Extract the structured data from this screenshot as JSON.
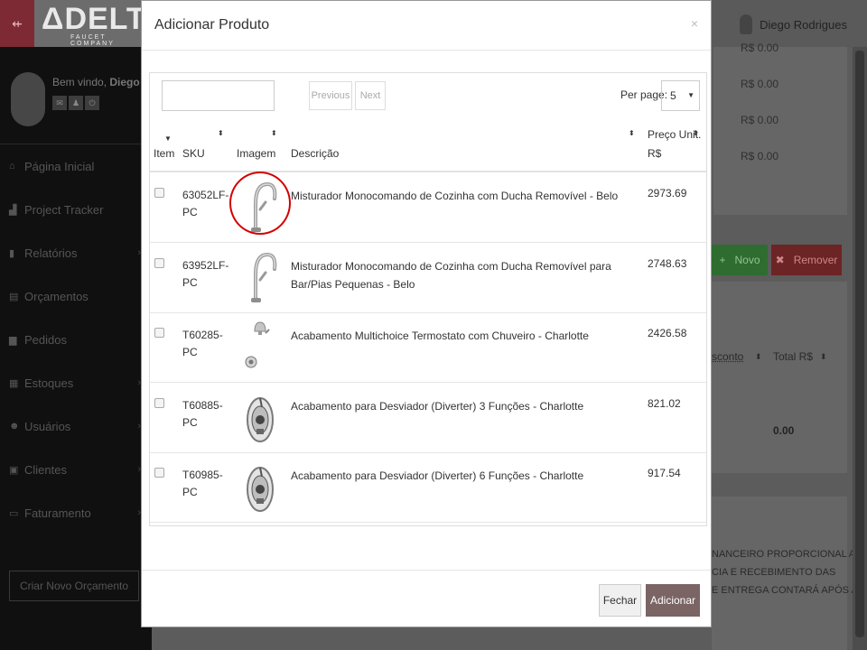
{
  "topbar": {
    "menu_icon": "menu-toggle-icon",
    "logo_text": "ΔDELTA",
    "logo_sub": "FAUCET COMPANY",
    "user_name": "Diego Rodrigues"
  },
  "sidebar": {
    "welcome_prefix": "Bem vindo,",
    "welcome_name": "Diego",
    "items": [
      {
        "label": "Página Inicial",
        "icon": "dashboard-icon",
        "glyph": "⌂",
        "has_submenu": false
      },
      {
        "label": "Project Tracker",
        "icon": "building-icon",
        "glyph": "▟",
        "has_submenu": false
      },
      {
        "label": "Relatórios",
        "icon": "bar-chart-icon",
        "glyph": "▮",
        "has_submenu": true
      },
      {
        "label": "Orçamentos",
        "icon": "document-icon",
        "glyph": "▤",
        "has_submenu": false
      },
      {
        "label": "Pedidos",
        "icon": "truck-icon",
        "glyph": "▆",
        "has_submenu": false
      },
      {
        "label": "Estoques",
        "icon": "inventory-icon",
        "glyph": "▦",
        "has_submenu": true
      },
      {
        "label": "Usuários",
        "icon": "users-icon",
        "glyph": "☻",
        "has_submenu": true
      },
      {
        "label": "Clientes",
        "icon": "briefcase-icon",
        "glyph": "▣",
        "has_submenu": true
      },
      {
        "label": "Faturamento",
        "icon": "money-icon",
        "glyph": "▭",
        "has_submenu": true
      }
    ],
    "new_quote_label": "Criar Novo Orçamento"
  },
  "background": {
    "prices": [
      "R$ 0.00",
      "R$ 0.00",
      "R$ 0.00",
      "R$ 0.00"
    ],
    "novo_label": "Novo",
    "remover_label": "Remover",
    "col_desconto": "sconto",
    "col_total": "Total R$",
    "total_value": "0.00",
    "notes": [
      "NANCEIRO PROPORCIONAL A",
      "CIA E RECEBIMENTO DAS",
      "E ENTREGA CONTARÁ APÓS A"
    ]
  },
  "modal": {
    "title": "Adicionar Produto",
    "close_label": "×",
    "search": {
      "value": "",
      "placeholder": ""
    },
    "pagination": {
      "previous": "Previous",
      "next": "Next"
    },
    "per_page_label": "Per page:",
    "per_page_value": "5",
    "columns": {
      "item": "Item",
      "sku": "SKU",
      "imagem": "Imagem",
      "descricao": "Descrição",
      "preco": "Preço Unit.",
      "preco_unit": "R$"
    },
    "rows": [
      {
        "sku": "63052LF-PC",
        "description": "Misturador Monocomando de Cozinha com Ducha Removível - Belo",
        "price": "2973.69",
        "image_type": "faucet",
        "highlighted": true
      },
      {
        "sku": "63952LF-PC",
        "description": "Misturador Monocomando de Cozinha com Ducha Removível para Bar/Pias Pequenas - Belo",
        "price": "2748.63",
        "image_type": "faucet",
        "highlighted": false
      },
      {
        "sku": "T60285-PC",
        "description": "Acabamento Multichoice Termostato com Chuveiro - Charlotte",
        "price": "2426.58",
        "image_type": "shower-set",
        "highlighted": false
      },
      {
        "sku": "T60885-PC",
        "description": "Acabamento para Desviador (Diverter) 3 Funções - Charlotte",
        "price": "821.02",
        "image_type": "diverter",
        "highlighted": false
      },
      {
        "sku": "T60985-PC",
        "description": "Acabamento para Desviador (Diverter) 6 Funções - Charlotte",
        "price": "917.54",
        "image_type": "diverter",
        "highlighted": false
      }
    ],
    "footer": {
      "close_label": "Fechar",
      "add_label": "Adicionar"
    }
  }
}
